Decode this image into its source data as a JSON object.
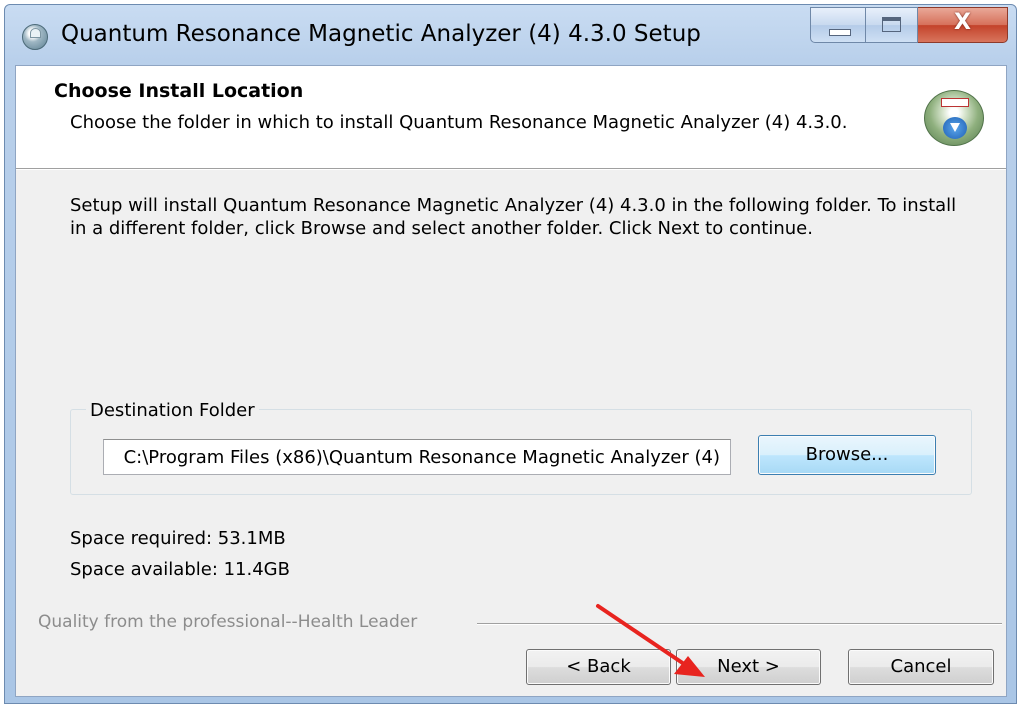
{
  "window": {
    "title": "Quantum Resonance Magnetic Analyzer (4) 4.3.0 Setup",
    "close_glyph": "X"
  },
  "header": {
    "title": "Choose Install Location",
    "subtitle": "Choose the folder in which to install Quantum Resonance Magnetic Analyzer (4) 4.3.0."
  },
  "body": {
    "intro": "Setup will install Quantum Resonance Magnetic Analyzer (4) 4.3.0 in the following folder. To install in a different folder, click Browse and select another folder. Click Next to continue."
  },
  "destination": {
    "label": "Destination Folder",
    "path": "C:\\Program Files (x86)\\Quantum Resonance Magnetic Analyzer (4)",
    "browse_label": "Browse..."
  },
  "space": {
    "required": "Space required: 53.1MB",
    "available": "Space available: 11.4GB"
  },
  "footer": {
    "brand": "Quality from the professional--Health Leader",
    "back_label": "< Back",
    "next_label": "Next >",
    "cancel_label": "Cancel"
  },
  "colors": {
    "annotation_arrow": "#e8241f",
    "title_bar": "#b9d0eb",
    "close_button": "#c3422a"
  },
  "icons": [
    "app-icon",
    "minimize-icon",
    "maximize-icon",
    "close-icon",
    "installer-logo-icon",
    "red-pointer-arrow-icon"
  ]
}
